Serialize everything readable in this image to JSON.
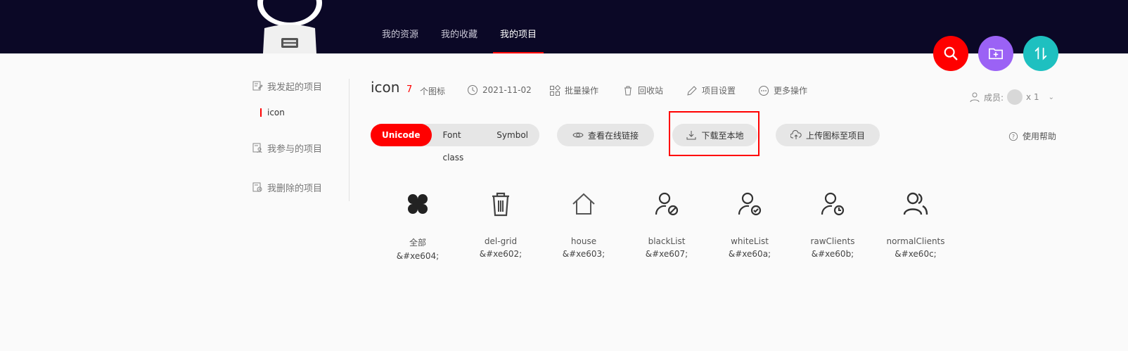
{
  "topnav": {
    "items": [
      {
        "label": "我的资源"
      },
      {
        "label": "我的收藏"
      },
      {
        "label": "我的项目"
      }
    ]
  },
  "fabs": {
    "search_color": "#ff0000",
    "folder_color": "#9b62f5",
    "sort_color": "#1ec0c0",
    "icons": [
      "search-icon",
      "folder-add-icon",
      "sort-icon"
    ]
  },
  "sidebar": {
    "groups": [
      {
        "label": "我发起的项目",
        "icon": "edit-doc-icon"
      },
      {
        "label": "我参与的项目",
        "icon": "user-doc-icon"
      },
      {
        "label": "我删除的项目",
        "icon": "delete-doc-icon"
      }
    ],
    "sub_item": "icon"
  },
  "project": {
    "title": "icon",
    "count": "7",
    "count_label": "个图标",
    "date": "2021-11-02",
    "actions": [
      {
        "label": "批量操作",
        "icon": "batch-icon"
      },
      {
        "label": "回收站",
        "icon": "trash-icon"
      },
      {
        "label": "项目设置",
        "icon": "pencil-icon"
      },
      {
        "label": "更多操作",
        "icon": "more-icon"
      }
    ],
    "members_label": "成员:",
    "members_count": "x 1"
  },
  "tabs": {
    "options": [
      "Unicode",
      "Font class",
      "Symbol"
    ],
    "active": "Unicode"
  },
  "buttons": {
    "view_online": "查看在线链接",
    "download": "下载至本地",
    "upload": "上传图标至项目",
    "help": "使用帮助"
  },
  "icons": [
    {
      "name": "全部",
      "code": "&#xe604;",
      "icon": "four-leaf-icon"
    },
    {
      "name": "del-grid",
      "code": "&#xe602;",
      "icon": "trash-can-icon"
    },
    {
      "name": "house",
      "code": "&#xe603;",
      "icon": "house-icon"
    },
    {
      "name": "blackList",
      "code": "&#xe607;",
      "icon": "user-blocked-icon"
    },
    {
      "name": "whiteList",
      "code": "&#xe60a;",
      "icon": "user-check-icon"
    },
    {
      "name": "rawClients",
      "code": "&#xe60b;",
      "icon": "user-clock-icon"
    },
    {
      "name": "normalClients",
      "code": "&#xe60c;",
      "icon": "users-icon"
    }
  ],
  "colors": {
    "header_bg": "#0b0826",
    "accent": "#ff0000"
  }
}
